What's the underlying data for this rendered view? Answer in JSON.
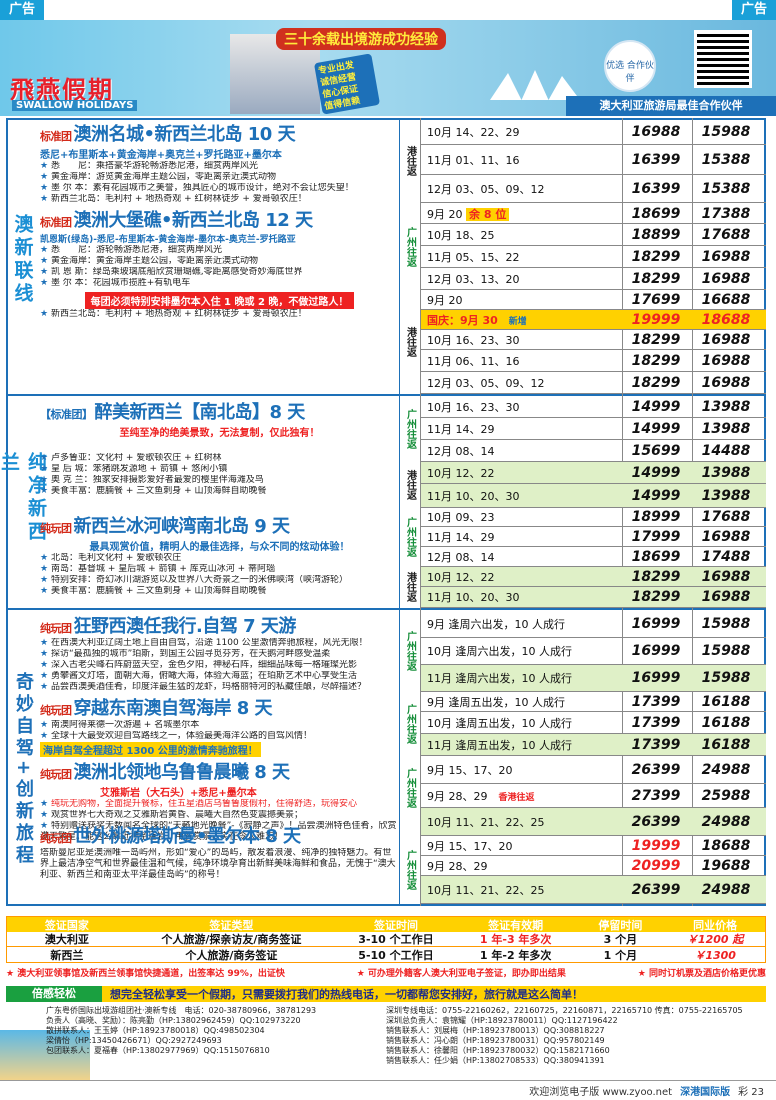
{
  "ad_label": "广告",
  "header": {
    "logo_cn": "飛燕假期",
    "logo_en": "SWALLOW HOLIDAYS",
    "slogan": "三十余载出境游成功经验",
    "stamp_lines": [
      "专业出发",
      "诚信经营",
      "值得信赖",
      "信心保证"
    ],
    "partner": "优选 合作伙伴",
    "tagline": "澳大利亚旅游局最佳合作伙伴"
  },
  "sections": [
    {
      "label": "澳新联线",
      "products": [
        {
          "tag": "标准团",
          "title": "澳洲名城•新西兰北岛 10 天",
          "subtitle": "悉尼+布里斯本+黄金海岸+奥克兰+罗托路亚+墨尔本",
          "lines": [
            [
              "悉　　尼",
              "乘搭豪华游轮畅游悉尼港，细赏两岸风光"
            ],
            [
              "黄金海岸",
              "游览黄金海岸主题公园，零距离亲近澳式动物"
            ],
            [
              "墨 尔 本",
              "素有花园城市之美誉，独具匠心的城市设计，绝对不会让您失望！"
            ],
            [
              "新西兰北岛",
              "毛利村 + 地热奇观 + 红树林徒步 + 爱哥顿农庄！"
            ]
          ]
        },
        {
          "tag": "标准团",
          "title": "澳洲大堡礁•新西兰北岛 12 天",
          "subtitle": "凯恩斯(绿岛)-悉尼-布里斯本-黄金海岸-墨尔本-奥克兰-罗托路亚",
          "lines": [
            [
              "悉　　尼",
              "游轮畅游悉尼港，细赏两岸风光"
            ],
            [
              "黄金海岸",
              "黄金海岸主题公园，零距离亲近澳式动物"
            ],
            [
              "凯 恩 斯",
              "绿岛乘玻璃底船欣赏珊瑚礁,零距离感受奇妙海底世界"
            ],
            [
              "墨 尔 本",
              "花园城市揽胜+有轨电车"
            ]
          ],
          "highlight": "每团必须特别安排墨尔本入住 1 晚或 2 晚，不做过路人！",
          "extra": [
            "新西兰北岛",
            "毛利村 + 地热奇观 + 红树林徒步 + 爱哥顿农庄！"
          ]
        }
      ]
    },
    {
      "label": "纯净新西兰",
      "products": [
        {
          "tag": "【标准团】",
          "title": "醉美新西兰【南北岛】8 天",
          "subtitle": "至纯至净的绝美景致，无法复制，仅此独有！",
          "lines": [
            [
              "卢多鲁亚",
              "文化村 + 爱歌顿农庄 + 红树林"
            ],
            [
              "皇 后 城",
              "笨猪跳发源地 + 箭镇 + 悠闲小镇"
            ],
            [
              "奥 克 兰",
              "独家安排摄影爱好者最爱的樱里伴海滩及鸟"
            ],
            [
              "美食丰富",
              "鹿腩餐 + 三文鱼刺身 + 山顶海鲜自助晚餐"
            ]
          ]
        },
        {
          "tag": "纯玩团",
          "title": "新西兰冰河峡湾南北岛 9 天",
          "subtitle": "最具观赏价值，精明人的最佳选择，与众不同的炫动体验！",
          "lines": [
            [
              "北岛",
              "毛利文化村 + 爱歌顿农庄"
            ],
            [
              "南岛",
              "基督城 + 皇后城 + 箭镇 + 库克山冰河 + 蒂阿瑙"
            ],
            [
              "特别安排",
              "奇幻冰川湖游览以及世界八大奇景之一的米佛峡湾（峡湾游轮）"
            ],
            [
              "美食丰富",
              "鹿腩餐 + 三文鱼刺身 + 山顶海鲜自助晚餐"
            ]
          ]
        }
      ]
    },
    {
      "label": "奇妙自驾+创新旅程",
      "products": [
        {
          "tag": "纯玩团",
          "title": "狂野西澳任我行.自驾 7 天游",
          "lines": [
            [
              "",
              "在西澳大利亚辽阔土地上自由自驾，沿途 1100 公里激情奔驰旅程，风光无限！"
            ],
            [
              "",
              "探访“最孤独的城市”珀斯，到国王公园寻觅芬芳，在天鹅河畔感受温柔"
            ],
            [
              "",
              "深入古老尖峰石阵蔚蓝天空，金色夕阳，神秘石阵，细细品味每一格璀璨光影"
            ],
            [
              "",
              "勇攀酱文灯塔，面朝大海，俯瞰大海，体验大海蓝；在珀斯艺术中心享受生活"
            ],
            [
              "",
              "品尝西澳美酒佳肴，印度洋最生猛的龙虾，玛格丽特河的私藏佳酿，尽醉描述？"
            ]
          ]
        },
        {
          "tag": "纯玩团",
          "title": "穿越东南澳自驾海岸 8 天",
          "lines": [
            [
              "",
              "南澳阿得莱德一次游遍 + 名城墨尔本"
            ],
            [
              "",
              "全球十大最受欢迎自驾路线之一，体验最美海洋公路的自驾风情！"
            ]
          ],
          "highlight": "海岸自驾全程超过 1300 公里的激情奔驰旅程！"
        },
        {
          "tag": "纯玩团",
          "title": "澳洲北领地乌鲁鲁晨曦 8 天",
          "subtitle": "艾雅斯岩（大石头）+悉尼+墨尔本",
          "lines": [
            [
              "",
              "纯玩无购物，全面提升餐标，住五星酒店乌鲁鲁度假村，住得舒适，玩得安心"
            ],
            [
              "",
              "观赏世界七大奇观之艾雅斯岩黄昏、晨曦大自然色变震撼美景；"
            ],
            [
              "",
              "特别赠送获奖无数闻名全球的“天籁地光晚餐”-《寂静之声》！品尝澳洲特色佳肴，欣赏满天繁星。能这么靠近神圣巨岩，用餐赏景，实在令人难忘！"
            ]
          ]
        },
        {
          "tag": "纯玩团",
          "title": "世外桃源塔斯曼•墨尔本 8 天",
          "lines": [
            [
              "",
              "塔斯曼尼亚是澳洲唯一岛屿州，形如“爱心”的岛屿，散发着浪漫、纯净的独特魅力。有世界上最洁净空气和世界最佳温和气候，纯净环境孕育出新鲜美味海鲜和食品，无愧于“澳大利亚、新西兰和南亚太平洋最佳岛屿”的称号！"
            ]
          ]
        }
      ]
    }
  ],
  "prices": {
    "p1": [
      [
        "10月 14、22、29",
        "16988",
        "15988"
      ],
      [
        "11月 01、11、16",
        "16399",
        "15388"
      ],
      [
        "12月 03、05、09、12",
        "16399",
        "15388"
      ]
    ],
    "p1_via": "港往返",
    "p2a": [
      [
        "9月 20",
        "18699",
        "17388"
      ],
      [
        "10月 18、25",
        "18899",
        "17688"
      ],
      [
        "11月 05、15、22",
        "18299",
        "16988"
      ],
      [
        "12月 03、13、20",
        "18299",
        "16988"
      ]
    ],
    "p2a_note": "余 8 位",
    "p2a_via": "广州往返",
    "p2b": [
      [
        "9月 20",
        "17699",
        "16688"
      ],
      [
        "国庆：9月 30",
        "19999",
        "18688"
      ],
      [
        "10月 16、23、30",
        "18299",
        "16988"
      ],
      [
        "11月 06、11、16",
        "18299",
        "16988"
      ],
      [
        "12月 03、05、09、12",
        "18299",
        "16988"
      ]
    ],
    "p2b_via": "港往返",
    "p2b_new": "新增",
    "p3a": [
      [
        "10月 16、23、30",
        "14999",
        "13988"
      ],
      [
        "11月 14、29",
        "14999",
        "13988"
      ],
      [
        "12月 08、14",
        "15699",
        "14488"
      ]
    ],
    "p3a_via": "广州往返",
    "p3b": [
      [
        "10月 12、22",
        "14999",
        "13988"
      ],
      [
        "11月 10、20、30",
        "14999",
        "13988"
      ]
    ],
    "p3b_via": "港往返",
    "p4a": [
      [
        "10月 09、23",
        "18999",
        "17688"
      ],
      [
        "11月 14、29",
        "17999",
        "16988"
      ],
      [
        "12月 08、14",
        "18699",
        "17488"
      ]
    ],
    "p4a_via": "广州往返",
    "p4b": [
      [
        "10月 12、22",
        "18299",
        "16988"
      ],
      [
        "11月 10、20、30",
        "18299",
        "16988"
      ]
    ],
    "p4b_via": "港往返",
    "p5": [
      [
        "9月 逢周六出发，10 人成行",
        "16999",
        "15988"
      ],
      [
        "10月 逢周六出发，10 人成行",
        "16999",
        "15988"
      ],
      [
        "11月 逢周六出发，10 人成行",
        "16999",
        "15988"
      ]
    ],
    "p5_via": "广州往返",
    "p6": [
      [
        "9月 逢周五出发，10 人成行",
        "17399",
        "16188"
      ],
      [
        "10月 逢周五出发，10 人成行",
        "17399",
        "16188"
      ],
      [
        "11月 逢周五出发，10 人成行",
        "17399",
        "16188"
      ]
    ],
    "p6_via": "广州往返",
    "p7": [
      [
        "9月 15、17、20",
        "26399",
        "24988"
      ],
      [
        "9月 28、29",
        "27399",
        "25988"
      ],
      [
        "10月 11、21、22、25",
        "26399",
        "24988"
      ]
    ],
    "p7_via": "广州往返",
    "p7_note": "香港往返",
    "p8": [
      [
        "9月 15、17、20",
        "19999",
        "18688"
      ],
      [
        "9月 28、29",
        "20999",
        "19688"
      ],
      [
        "10月 11、21、22、25",
        "26399",
        "24988"
      ]
    ],
    "p8_via": "广州往返"
  },
  "visa": {
    "headers": [
      "签证国家",
      "签证类型",
      "签证时间",
      "签证有效期",
      "停留时间",
      "同业价格"
    ],
    "rows": [
      [
        "澳大利亚",
        "个人旅游/探亲访友/商务签证",
        "3-10 个工作日",
        "1 年-3 年多次",
        "3 个月",
        "￥1200 起"
      ],
      [
        "新西兰",
        "个人旅游/商务签证",
        "5-10 个工作日",
        "1 年-2 年多次",
        "1 个月",
        "￥1300"
      ]
    ],
    "notes": [
      "★ 澳大利亚领事馆及新西兰领事馆快捷通道，出签率达 99%，出证快",
      "★ 可办理外籍客人澳大利亚电子签证，即办即出结果",
      "★ 同时订机票及酒店价格更优惠"
    ]
  },
  "relax": {
    "label": "倍感轻松",
    "text": "想完全轻松享受一个假期，只需要拨打我们的热线电话，一切都帮您安排好，旅行就是这么简单！"
  },
  "contact": {
    "left": [
      "广东粤侨国际出境游组团社·澳新专线　电话：020-38780966，38781293",
      "负责人（高晓、奖励）：陈亮勤（HP:13802962459）QQ:102973220",
      "散拼联系人：王玉婷（HP:18923780018）QQ:498502304",
      "梁倩怡（HP:13450426671）QQ:2927249693",
      "包团联系人：夏福春（HP:13802977969）QQ:1515076810"
    ],
    "right": [
      "深圳专线电话：0755-22160262，22160725，22160871，22165710 传真：0755-22165705",
      "深圳总负责人：袁锦耀（HP:18923780011）QQ:1127196422",
      "销售联系人：刘展梅（HP:18923780013）QQ:308818227",
      "销售联系人：冯心朗（HP:18923780031）QQ:957802149",
      "销售联系人：徐馨阳（HP:18923780032）QQ:1582171660",
      "销售联系人：任少娟（HP:13802708533）QQ:380941391"
    ]
  },
  "footer": {
    "welcome": "欢迎浏览电子版 www.zyoo.net",
    "brand": "深港国际版",
    "page": "彩 23"
  }
}
